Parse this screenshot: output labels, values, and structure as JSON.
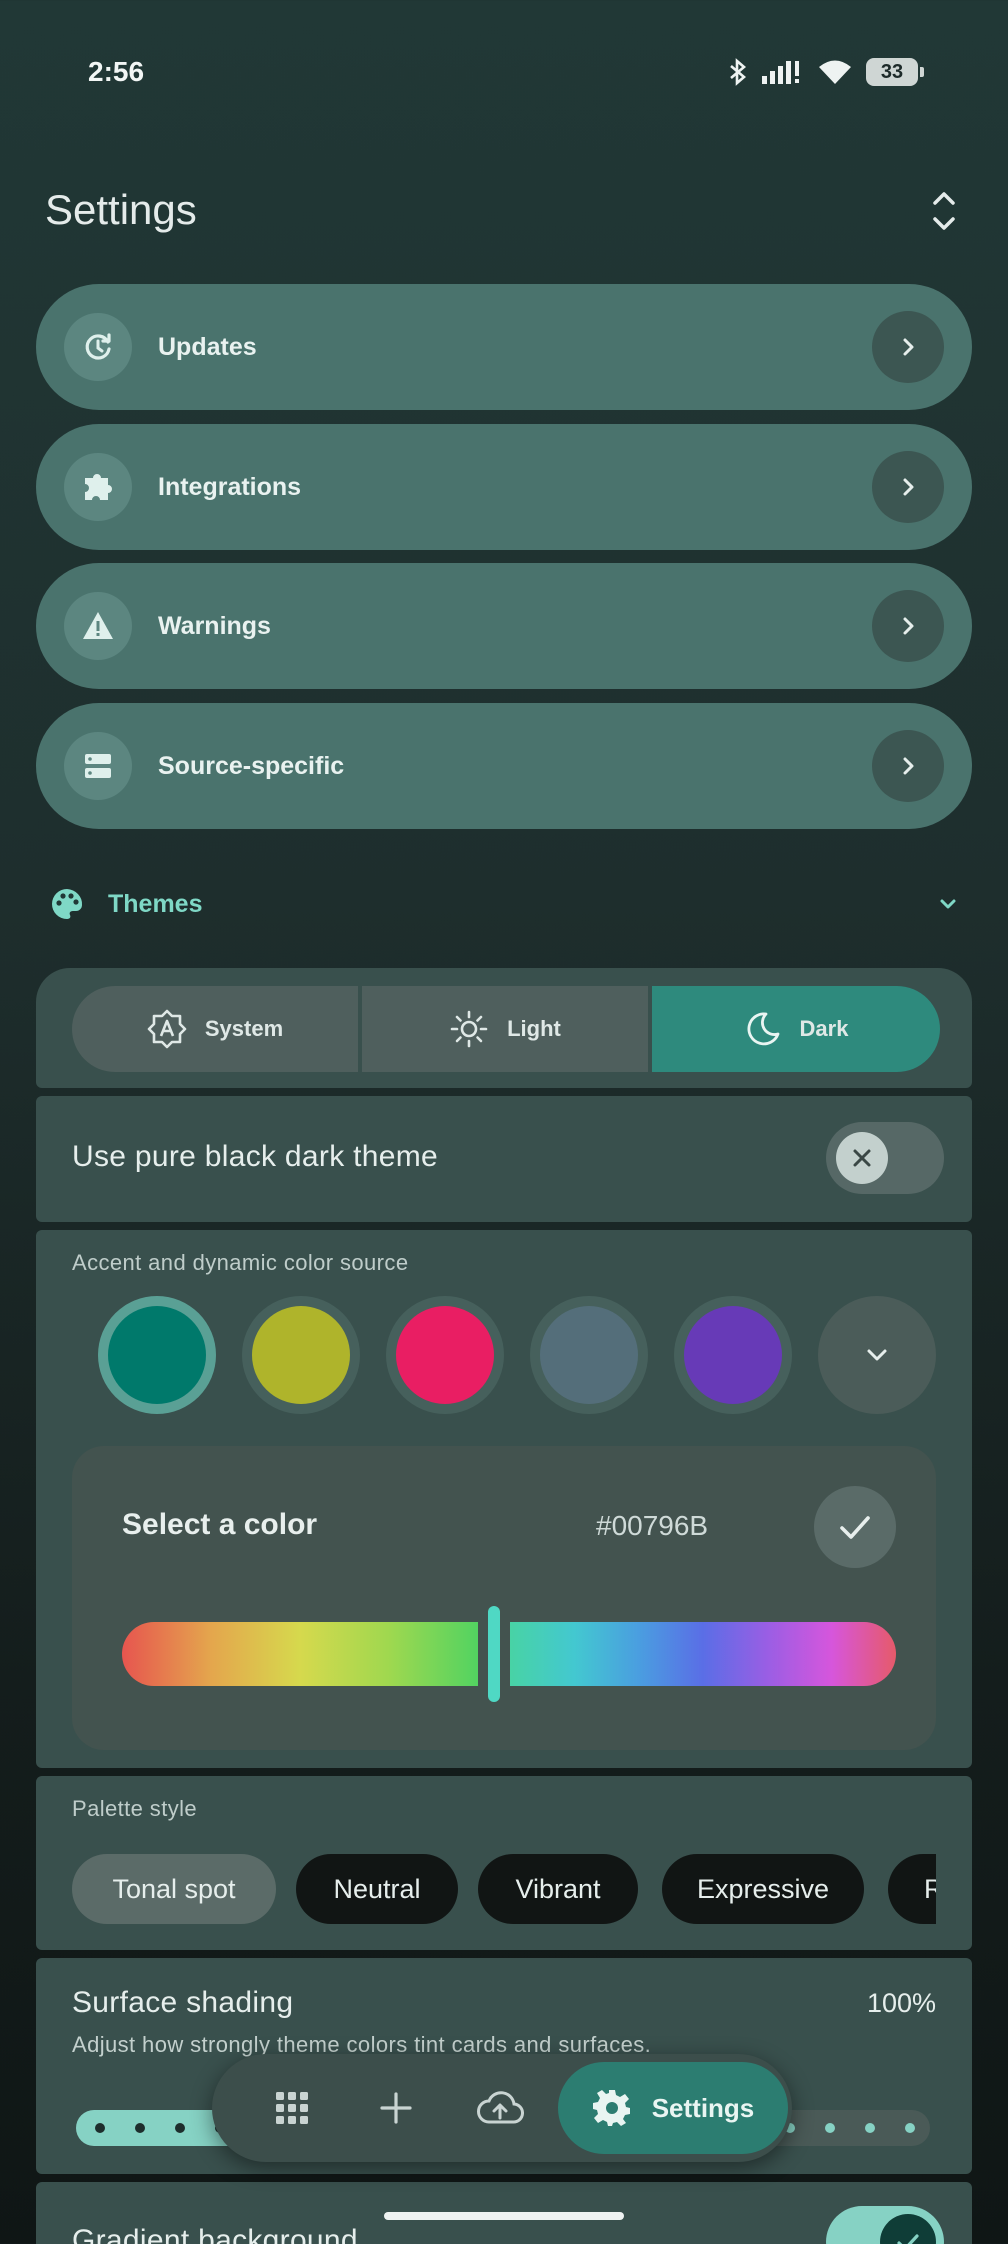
{
  "status_bar": {
    "time": "2:56",
    "battery": "33"
  },
  "header": {
    "title": "Settings"
  },
  "nav_items": [
    {
      "label": "Updates",
      "icon": "update-icon"
    },
    {
      "label": "Integrations",
      "icon": "puzzle-icon"
    },
    {
      "label": "Warnings",
      "icon": "warning-icon"
    },
    {
      "label": "Source-specific",
      "icon": "storage-icon"
    }
  ],
  "themes": {
    "section_label": "Themes",
    "options": [
      "System",
      "Light",
      "Dark"
    ],
    "selected": "Dark",
    "pure_black_label": "Use pure black dark theme",
    "pure_black_enabled": false
  },
  "accent": {
    "label": "Accent and dynamic color source",
    "swatches": [
      "#00796B",
      "#AFB42B",
      "#E91E63",
      "#546E7A",
      "#673AB7"
    ],
    "selected_index": 0,
    "picker_title": "Select a color",
    "hex_value": "#00796B"
  },
  "palette": {
    "label": "Palette style",
    "chips": [
      "Tonal spot",
      "Neutral",
      "Vibrant",
      "Expressive",
      "R"
    ],
    "selected": "Tonal spot"
  },
  "surface_shading": {
    "title": "Surface shading",
    "description": "Adjust how strongly theme colors tint cards and surfaces.",
    "value": "100%"
  },
  "gradient_background": {
    "label": "Gradient background",
    "enabled": true
  },
  "bottom_nav": {
    "active_label": "Settings"
  },
  "colors": {
    "accent": "#7fd8c6",
    "active": "#2e8a7d"
  }
}
